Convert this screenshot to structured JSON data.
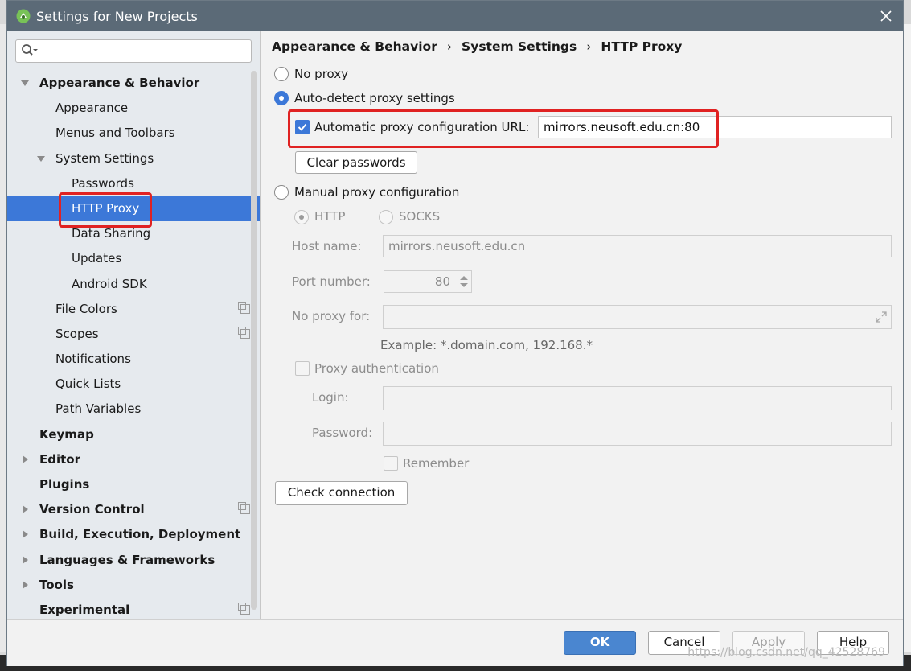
{
  "window": {
    "title": "Settings for New Projects"
  },
  "search": {
    "placeholder": ""
  },
  "sidebar": {
    "items": [
      {
        "label": "Appearance & Behavior"
      },
      {
        "label": "Appearance"
      },
      {
        "label": "Menus and Toolbars"
      },
      {
        "label": "System Settings"
      },
      {
        "label": "Passwords"
      },
      {
        "label": "HTTP Proxy"
      },
      {
        "label": "Data Sharing"
      },
      {
        "label": "Updates"
      },
      {
        "label": "Android SDK"
      },
      {
        "label": "File Colors"
      },
      {
        "label": "Scopes"
      },
      {
        "label": "Notifications"
      },
      {
        "label": "Quick Lists"
      },
      {
        "label": "Path Variables"
      },
      {
        "label": "Keymap"
      },
      {
        "label": "Editor"
      },
      {
        "label": "Plugins"
      },
      {
        "label": "Version Control"
      },
      {
        "label": "Build, Execution, Deployment"
      },
      {
        "label": "Languages & Frameworks"
      },
      {
        "label": "Tools"
      },
      {
        "label": "Experimental"
      }
    ]
  },
  "breadcrumb": [
    "Appearance & Behavior",
    "System Settings",
    "HTTP Proxy"
  ],
  "proxy": {
    "no_proxy": "No proxy",
    "auto_detect": "Auto-detect proxy settings",
    "auto_url_label": "Automatic proxy configuration URL:",
    "auto_url_value": "mirrors.neusoft.edu.cn:80",
    "clear_passwords": "Clear passwords",
    "manual": "Manual proxy configuration",
    "http": "HTTP",
    "socks": "SOCKS",
    "host_label": "Host name:",
    "host_value": "mirrors.neusoft.edu.cn",
    "port_label": "Port number:",
    "port_value": "80",
    "no_proxy_for_label": "No proxy for:",
    "no_proxy_for_value": "",
    "example": "Example: *.domain.com, 192.168.*",
    "proxy_auth": "Proxy authentication",
    "login_label": "Login:",
    "password_label": "Password:",
    "remember": "Remember",
    "check_connection": "Check connection"
  },
  "footer": {
    "ok": "OK",
    "cancel": "Cancel",
    "apply": "Apply",
    "help": "Help",
    "watermark": "https://blog.csdn.net/qq_42528769"
  },
  "colors": {
    "accent": "#3c78d8",
    "highlight": "#e02222",
    "titlebar": "#5b6a77"
  }
}
